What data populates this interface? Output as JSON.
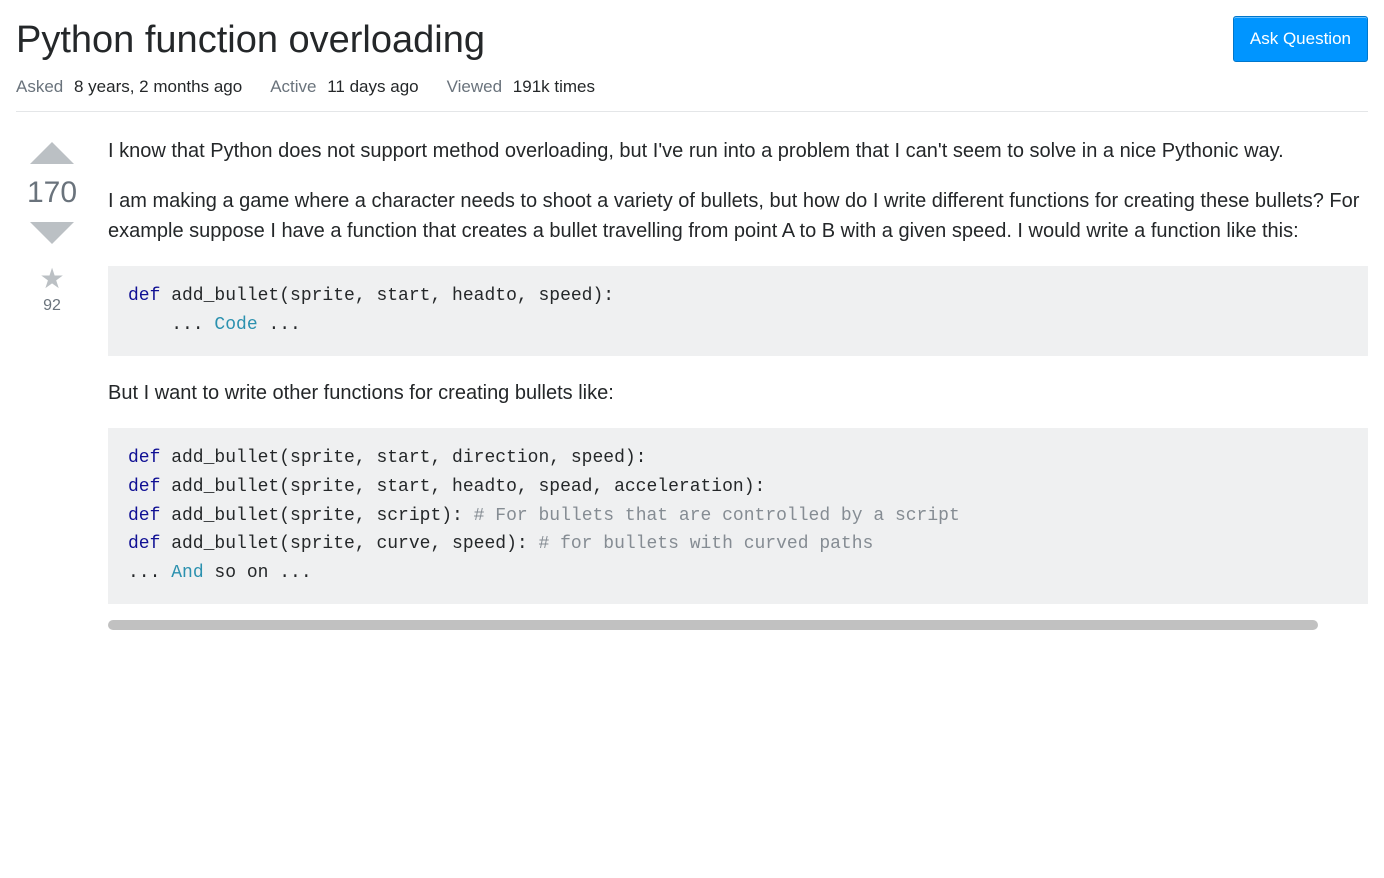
{
  "header": {
    "title": "Python function overloading",
    "ask_button": "Ask Question"
  },
  "meta": {
    "asked_label": "Asked",
    "asked_value": "8 years, 2 months ago",
    "active_label": "Active",
    "active_value": "11 days ago",
    "viewed_label": "Viewed",
    "viewed_value": "191k times"
  },
  "vote": {
    "score": "170",
    "favorites": "92"
  },
  "post": {
    "p1": "I know that Python does not support method overloading, but I've run into a problem that I can't seem to solve in a nice Pythonic way.",
    "p2": "I am making a game where a character needs to shoot a variety of bullets, but how do I write different functions for creating these bullets? For example suppose I have a function that creates a bullet travelling from point A to B with a given speed. I would write a function like this:",
    "p3": "But I want to write other functions for creating bullets like:",
    "code1": {
      "kw1": "def",
      "sig": " add_bullet(sprite, start, headto, speed):",
      "line2a": "    ... ",
      "code_word": "Code",
      "line2b": " ..."
    },
    "code2": {
      "kw": "def",
      "sig1": " add_bullet(sprite, start, direction, speed):",
      "sig2": " add_bullet(sprite, start, headto, spead, acceleration):",
      "sig3": " add_bullet(sprite, script): ",
      "com3": "# For bullets that are controlled by a script",
      "sig4": " add_bullet(sprite, curve, speed): ",
      "com4": "# for bullets with curved paths",
      "line5a": "... ",
      "and_word": "And",
      "line5b": " so on ..."
    }
  }
}
